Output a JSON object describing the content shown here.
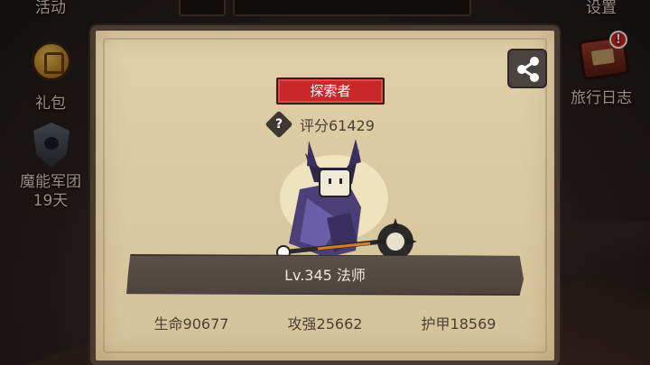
{
  "side_menu": {
    "left": [
      {
        "label": "活动",
        "icon": "event-icon"
      },
      {
        "label": "礼包",
        "icon": "gift-coin-icon"
      },
      {
        "label": "魔能军团",
        "sub": "19天",
        "icon": "legion-shield-icon"
      }
    ],
    "right": [
      {
        "label": "设置",
        "icon": "settings-icon"
      },
      {
        "label": "旅行日志",
        "icon": "journal-book-icon",
        "badge": "!"
      }
    ]
  },
  "profile": {
    "title": "探索者",
    "score": "评分61429",
    "help_glyph": "?",
    "level_class": "Lv.345 法师",
    "stats": [
      {
        "key": "hp",
        "text": "生命90677"
      },
      {
        "key": "attack",
        "text": "攻强25662"
      },
      {
        "key": "armor",
        "text": "护甲18569"
      }
    ]
  },
  "colors": {
    "panel": "#d8c59c",
    "title_plate": "#c9282a",
    "level_band": "#544a42",
    "alert": "#d9231e"
  }
}
